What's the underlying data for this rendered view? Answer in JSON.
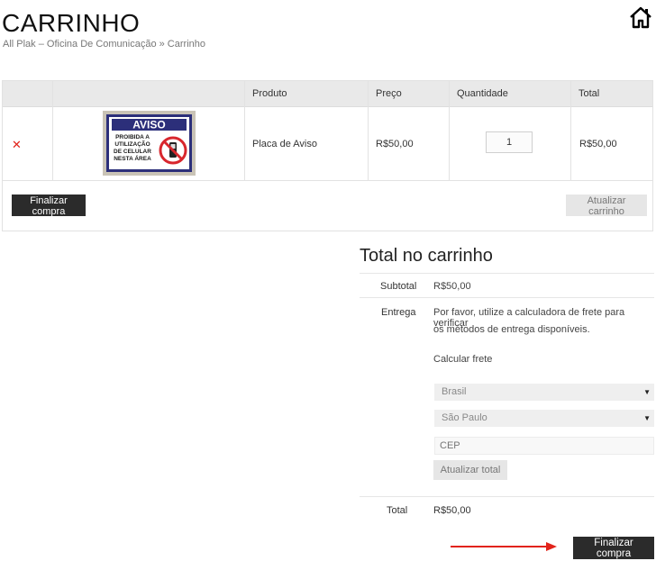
{
  "header": {
    "title": "CARRINHO",
    "breadcrumb": "All Plak – Oficina De Comunicação » Carrinho"
  },
  "cart": {
    "columns": [
      "Produto",
      "Preço",
      "Quantidade",
      "Total"
    ],
    "items": [
      {
        "product": "Placa de Aviso",
        "price": "R$50,00",
        "quantity": "1",
        "total": "R$50,00",
        "thumbnail": {
          "header": "AVISO",
          "lines": [
            "PROIBIDA A",
            "UTILIZAÇÃO",
            "DE CELULAR",
            "NESTA ÁREA"
          ]
        }
      }
    ],
    "checkout_label": "Finalizar compra",
    "update_label": "Atualizar carrinho"
  },
  "totals": {
    "title": "Total no carrinho",
    "subtotal_label": "Subtotal",
    "subtotal_value": "R$50,00",
    "shipping_label": "Entrega",
    "shipping_text_line1": "Por favor, utilize a calculadora de frete para verificar",
    "shipping_text_line2": "os métodos de entrega disponíveis.",
    "calc_label": "Calcular frete",
    "country_selected": "Brasil",
    "state_selected": "São Paulo",
    "cep_placeholder": "CEP",
    "update_total_label": "Atualizar total",
    "total_label": "Total",
    "total_value": "R$50,00",
    "checkout_label": "Finalizar compra"
  },
  "colors": {
    "remove": "#e2231a",
    "arrow": "#e2231a",
    "dark_button": "#2b2b2b",
    "table_header": "#e9e9e9"
  }
}
